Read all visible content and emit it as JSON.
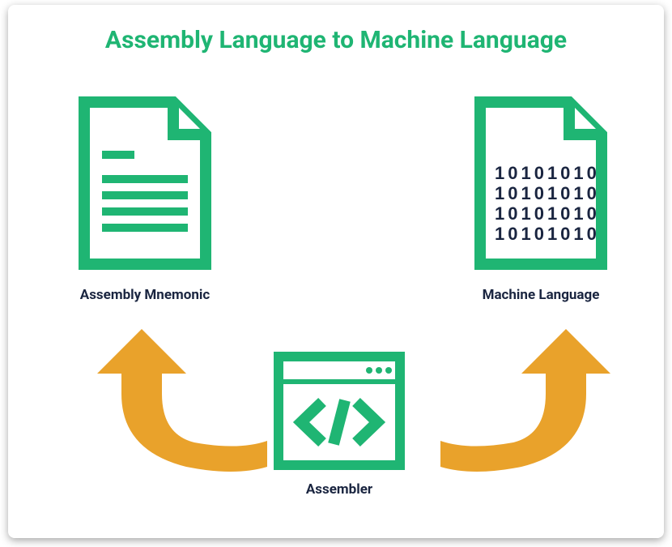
{
  "title": "Assembly Language to Machine Language",
  "mnemonic": {
    "label": "Assembly Mnemonic"
  },
  "machine": {
    "label": "Machine Language",
    "binary_lines": [
      "10101010",
      "10101010",
      "10101010",
      "10101010"
    ]
  },
  "assembler": {
    "label": "Assembler"
  },
  "colors": {
    "green": "#1fb573",
    "arrow": "#e9a22b",
    "dark": "#1a2540"
  }
}
